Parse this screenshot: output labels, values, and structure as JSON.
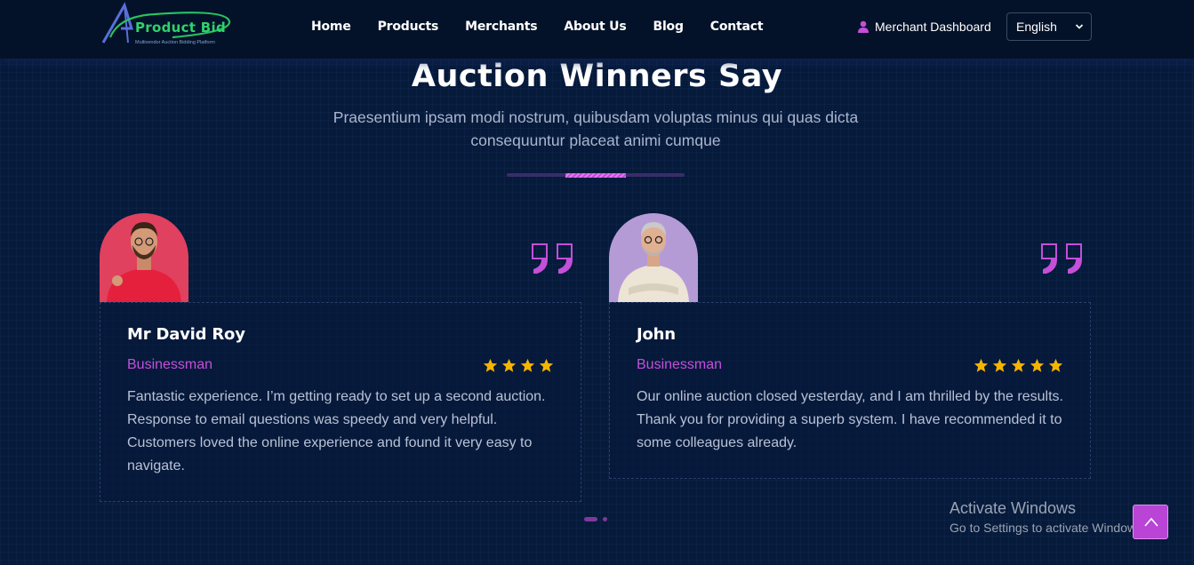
{
  "header": {
    "logo_text": "Product Bid",
    "logo_tagline": "Multivendor Auction Bidding Platform",
    "nav": [
      "Home",
      "Products",
      "Merchants",
      "About Us",
      "Blog",
      "Contact"
    ],
    "merchant_dashboard": "Merchant Dashboard",
    "language": "English"
  },
  "section": {
    "title": "Auction Winners Say",
    "subtitle": "Praesentium ipsam modi nostrum, quibusdam voluptas minus qui quas dicta consequuntur placeat animi cumque"
  },
  "testimonials": [
    {
      "name": "Mr David Roy",
      "role": "Businessman",
      "rating": 4,
      "text": "Fantastic experience. I’m getting ready to set up a second auction. Response to email questions was speedy and very helpful. Customers loved the online experience and found it very easy to navigate."
    },
    {
      "name": "John",
      "role": "Businessman",
      "rating": 5,
      "text": "Our online auction closed yesterday, and I am thrilled by the results. Thank you for providing a superb system. I have recommended it to some colleagues already."
    }
  ],
  "carousel": {
    "active_index": 0,
    "count": 2
  },
  "os_overlay": {
    "title": "Activate Windows",
    "subtitle": "Go to Settings to activate Windows."
  },
  "colors": {
    "accent": "#c44fd9",
    "background": "#061a3a",
    "star": "#f5b400"
  }
}
